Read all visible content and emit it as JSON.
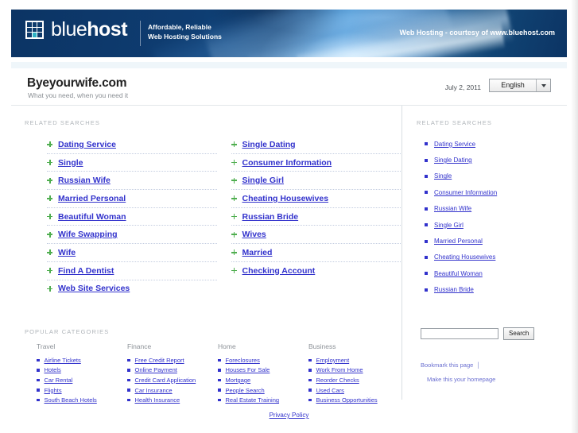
{
  "banner": {
    "logo_text_light": "blue",
    "logo_text_bold": "host",
    "tagline_line1": "Affordable, Reliable",
    "tagline_line2": "Web Hosting Solutions",
    "right_text": "Web Hosting - courtesy of www.bluehost.com"
  },
  "titlebar": {
    "site_title": "Byeyourwife.com",
    "site_subtitle": "What you need, when you need it",
    "date": "July 2, 2011",
    "language": "English"
  },
  "main": {
    "section_heading": "RELATED SEARCHES",
    "left_links": [
      "Dating Service",
      "Single",
      "Russian Wife",
      "Married Personal",
      "Beautiful Woman",
      "Wife Swapping",
      "Wife",
      "Find A Dentist",
      "Web Site Services"
    ],
    "right_links": [
      "Single Dating",
      "Consumer Information",
      "Single Girl",
      "Cheating Housewives",
      "Russian Bride",
      "Wives",
      "Married",
      "Checking Account"
    ]
  },
  "popular": {
    "heading": "POPULAR CATEGORIES",
    "columns": [
      {
        "title": "Travel",
        "items": [
          "Airline Tickets",
          "Hotels",
          "Car Rental",
          "Flights",
          "South Beach Hotels"
        ]
      },
      {
        "title": "Finance",
        "items": [
          "Free Credit Report",
          "Online Payment",
          "Credit Card Application",
          "Car Insurance",
          "Health Insurance"
        ]
      },
      {
        "title": "Home",
        "items": [
          "Foreclosures",
          "Houses For Sale",
          "Mortgage",
          "People Search",
          "Real Estate Training"
        ]
      },
      {
        "title": "Business",
        "items": [
          "Employment",
          "Work From Home",
          "Reorder Checks",
          "Used Cars",
          "Business Opportunities"
        ]
      }
    ]
  },
  "sidebar": {
    "section_heading": "RELATED SEARCHES",
    "links": [
      "Dating Service",
      "Single Dating",
      "Single",
      "Consumer Information",
      "Russian Wife",
      "Single Girl",
      "Married Personal",
      "Cheating Housewives",
      "Beautiful Woman",
      "Russian Bride"
    ],
    "search_value": "",
    "search_placeholder": "",
    "search_button": "Search",
    "bookmark_link": "Bookmark this page",
    "homepage_link": "Make this your homepage"
  },
  "footer": {
    "privacy_link": "Privacy Policy"
  },
  "colors": {
    "link_blue": "#3232cc",
    "banner_navy": "#0d3a6b",
    "plus_green": "#4fae4f",
    "heading_gray": "#b0b5ba"
  }
}
